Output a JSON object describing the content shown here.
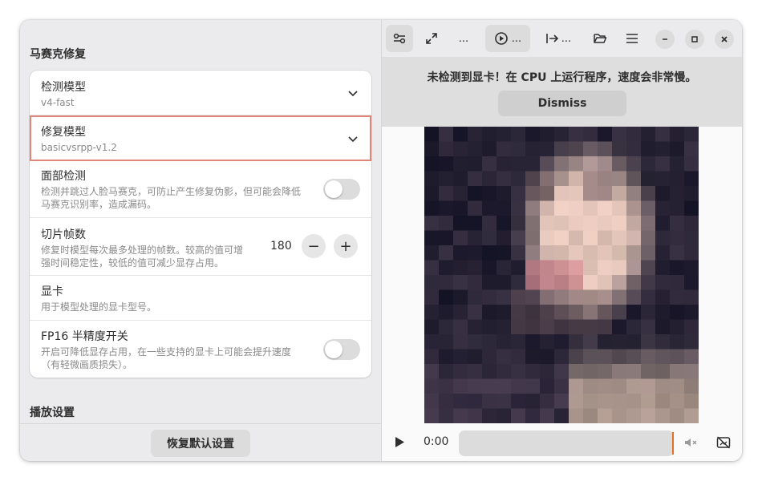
{
  "settings": {
    "section_title": "马赛克修复",
    "detection_model": {
      "label": "检测模型",
      "value": "v4-fast"
    },
    "restoration_model": {
      "label": "修复模型",
      "value": "basicvsrpp-v1.2"
    },
    "face_detection": {
      "label": "面部检测",
      "desc_line1": "检测并跳过人脸马赛克，可防止产生修复伪影，但可能会降低",
      "desc_line2": "马赛克识别率，造成漏码。",
      "enabled": false
    },
    "clip_frames": {
      "label": "切片帧数",
      "desc_line1": "修复时模型每次最多处理的帧数。较高的值可增",
      "desc_line2": "强时间稳定性，较低的值可减少显存占用。",
      "value": "180",
      "minus": "−",
      "plus": "+"
    },
    "gpu": {
      "label": "显卡",
      "desc": "用于模型处理的显卡型号。"
    },
    "fp16": {
      "label": "FP16 半精度开关",
      "desc_line1": "开启可降低显存占用，在一些支持的显卡上可能会提升速度",
      "desc_line2": "（有轻微画质损失）。",
      "enabled": false
    },
    "next_section_title": "播放设置",
    "reset_button": "恢复默认设置"
  },
  "header": {
    "more_label": "...",
    "play_menu_label": "...",
    "export_label": "..."
  },
  "banner": {
    "message": "未检测到显卡！在 CPU 上运行程序，速度会非常慢。",
    "dismiss": "Dismiss"
  },
  "player": {
    "time": "0:00",
    "progress": 1.0
  },
  "colors": {
    "selected_outline": "#e0857a",
    "seek_handle": "#e0702a"
  }
}
